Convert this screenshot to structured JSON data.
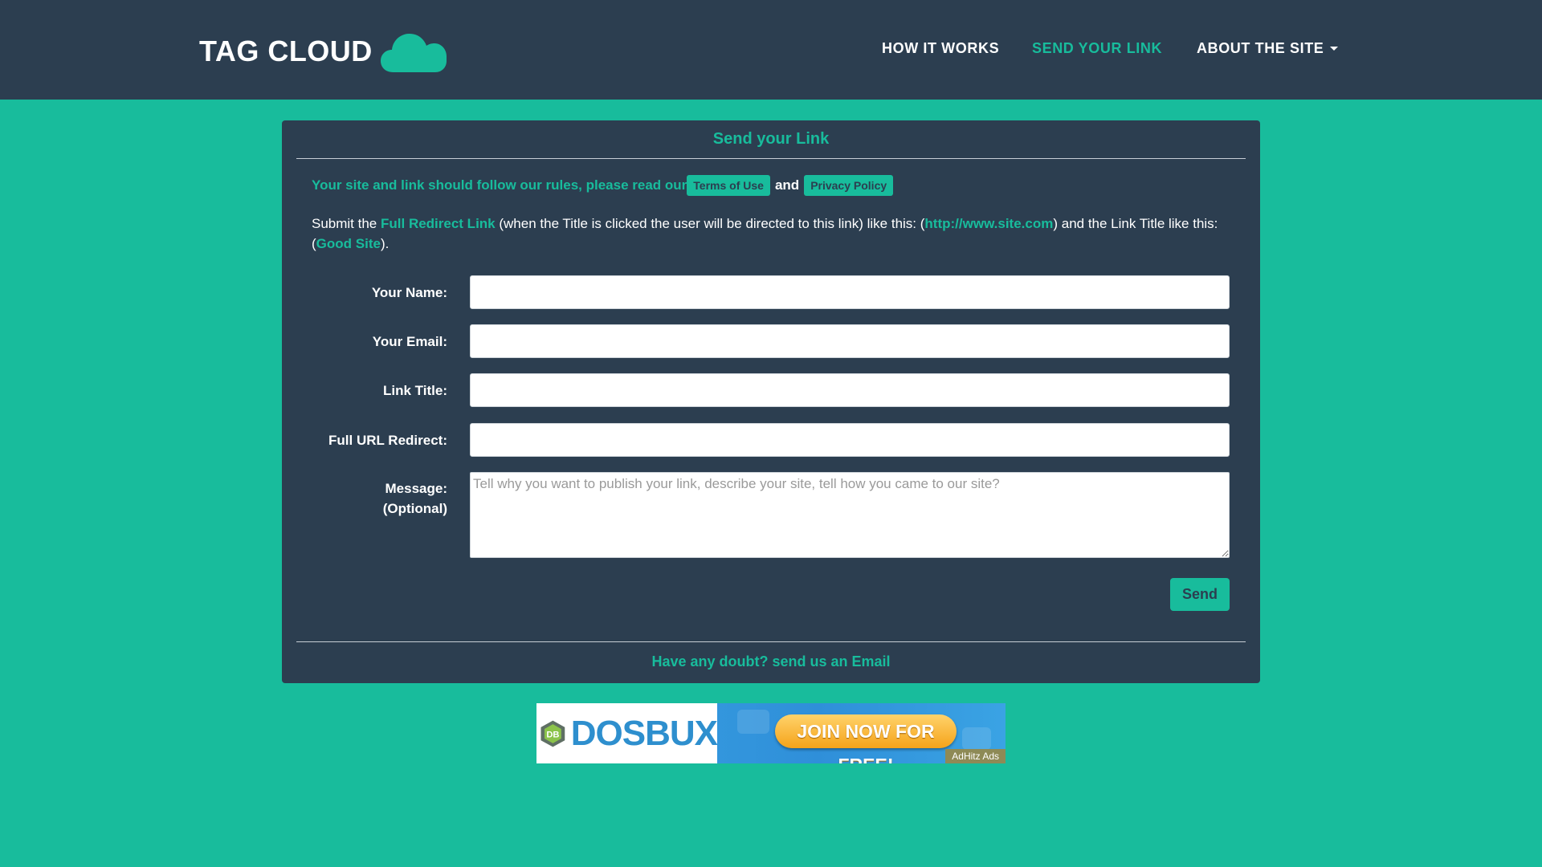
{
  "header": {
    "brand": "TAG CLOUD",
    "nav": [
      {
        "label": "HOW IT WORKS"
      },
      {
        "label": "SEND YOUR LINK",
        "active": true
      },
      {
        "label": "ABOUT THE SITE"
      }
    ]
  },
  "panel": {
    "title": "Send your Link",
    "rules_prefix": "Your site and link should follow our rules, please read our",
    "terms_label": "Terms of Use",
    "and_label": "and",
    "privacy_label": "Privacy Policy",
    "submit": {
      "t1": "Submit the ",
      "hl1": "Full Redirect Link",
      "t2": " (when the Title is clicked the user will be directed to this link) like this: (",
      "hl2": "http://www.site.com",
      "t3": ") and the Link Title like this: (",
      "hl3": "Good Site",
      "t4": ")."
    },
    "form": {
      "name_label": "Your Name:",
      "email_label": "Your Email:",
      "title_label": "Link Title:",
      "url_label": "Full URL Redirect:",
      "message_label": "Message:",
      "message_sub_label": "(Optional)",
      "message_placeholder": "Tell why you want to publish your link, describe your site, tell how you came to our site?",
      "send_label": "Send"
    },
    "footer_link": "Have any doubt? send us an Email"
  },
  "ad": {
    "logo_text": "DB",
    "brand": "DOSBUX",
    "cta": "JOIN NOW FOR FREE!",
    "tag": "AdHitz Ads"
  },
  "colors": {
    "accent": "#18bc9c",
    "dark": "#2c3e50"
  }
}
